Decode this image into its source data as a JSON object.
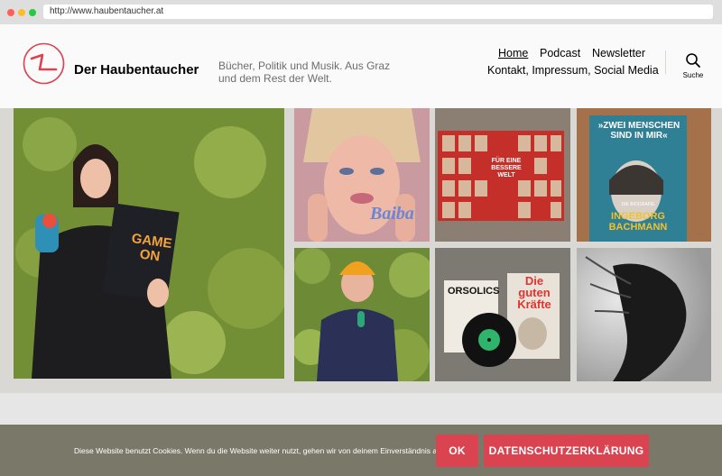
{
  "browser": {
    "url": "http://www.haubentaucher.at"
  },
  "site": {
    "title": "Der Haubentaucher",
    "tagline_line1": "Bücher, Politik und Musik. Aus Graz",
    "tagline_line2": "und dem Rest der Welt."
  },
  "nav": {
    "home": "Home",
    "podcast": "Podcast",
    "newsletter": "Newsletter",
    "contact": "Kontakt, Impressum, Social Media"
  },
  "search": {
    "label": "Suche",
    "icon": "search-icon"
  },
  "tiles": {
    "game_on_title": "GAME ON",
    "baiba_label": "Baiba",
    "buch1_title": "FÜR EINE BESSERE WELT",
    "bachmann_quote": "»ZWEI MENSCHEN SIND IN MIR«",
    "bachmann_sub": "DIE BIOGRAFIE",
    "bachmann_name": "INGEBORG BACHMANN",
    "orsolics_label": "ORSOLICS",
    "kraefte_title": "Die guten Kräfte"
  },
  "cookie": {
    "text": "Diese Website benutzt Cookies. Wenn du die Website weiter nutzt, gehen wir von deinem Einverständnis aus.",
    "ok_label": "OK",
    "privacy_label": "DATENSCHUTZERKLÄRUNG"
  },
  "colors": {
    "accent": "#d94450",
    "cookie_bg": "#7a7869"
  }
}
